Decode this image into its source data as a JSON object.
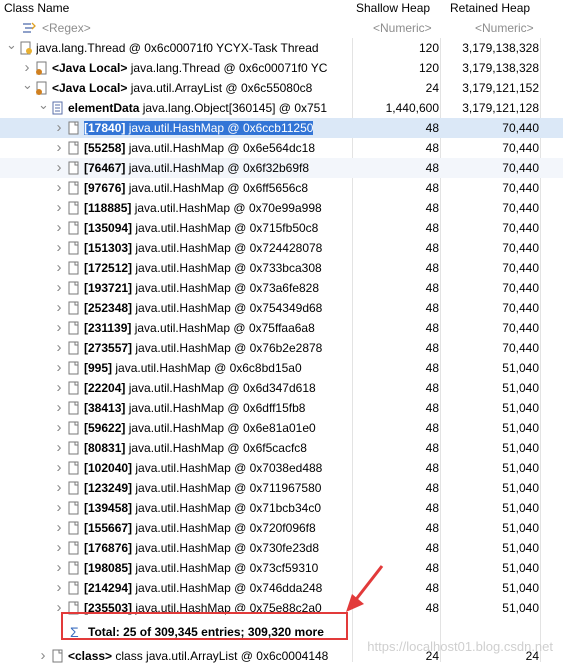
{
  "columns": {
    "class_name": "Class Name",
    "shallow_heap": "Shallow Heap",
    "retained_heap": "Retained Heap"
  },
  "filters": {
    "class_name": "<Regex>",
    "shallow_heap": "<Numeric>",
    "retained_heap": "<Numeric>"
  },
  "tree": [
    {
      "indent": 0,
      "expanded": true,
      "icon": "thread-icon",
      "text": "java.lang.Thread @ 0x6c00071f0  YCYX-Task Thread",
      "shallow": "120",
      "retained": "3,179,138,328"
    },
    {
      "indent": 1,
      "expanded": false,
      "icon": "local-icon",
      "text": "<Java Local> java.lang.Thread @ 0x6c00071f0  YC",
      "bold_prefix": "<Java Local>",
      "rest": " java.lang.Thread @ 0x6c00071f0  YC",
      "shallow": "120",
      "retained": "3,179,138,328"
    },
    {
      "indent": 1,
      "expanded": true,
      "icon": "local-icon",
      "text": "<Java Local> java.util.ArrayList @ 0x6c55080c8",
      "bold_prefix": "<Java Local>",
      "rest": " java.util.ArrayList @ 0x6c55080c8",
      "shallow": "24",
      "retained": "3,179,121,152"
    },
    {
      "indent": 2,
      "expanded": true,
      "icon": "array-icon",
      "text": "elementData java.lang.Object[360145] @ 0x751",
      "bold_prefix": "elementData",
      "rest": " java.lang.Object[360145] @ 0x751",
      "shallow": "1,440,600",
      "retained": "3,179,121,128"
    }
  ],
  "entries": [
    {
      "idx": "[17840]",
      "obj": "java.util.HashMap @ 0x6ccb11250",
      "shallow": "48",
      "retained": "70,440"
    },
    {
      "idx": "[55258]",
      "obj": "java.util.HashMap @ 0x6e564dc18",
      "shallow": "48",
      "retained": "70,440"
    },
    {
      "idx": "[76467]",
      "obj": "java.util.HashMap @ 0x6f32b69f8",
      "shallow": "48",
      "retained": "70,440"
    },
    {
      "idx": "[97676]",
      "obj": "java.util.HashMap @ 0x6ff5656c8",
      "shallow": "48",
      "retained": "70,440"
    },
    {
      "idx": "[118885]",
      "obj": "java.util.HashMap @ 0x70e99a998",
      "shallow": "48",
      "retained": "70,440"
    },
    {
      "idx": "[135094]",
      "obj": "java.util.HashMap @ 0x715fb50c8",
      "shallow": "48",
      "retained": "70,440"
    },
    {
      "idx": "[151303]",
      "obj": "java.util.HashMap @ 0x724428078",
      "shallow": "48",
      "retained": "70,440"
    },
    {
      "idx": "[172512]",
      "obj": "java.util.HashMap @ 0x733bca308",
      "shallow": "48",
      "retained": "70,440"
    },
    {
      "idx": "[193721]",
      "obj": "java.util.HashMap @ 0x73a6fe828",
      "shallow": "48",
      "retained": "70,440"
    },
    {
      "idx": "[252348]",
      "obj": "java.util.HashMap @ 0x754349d68",
      "shallow": "48",
      "retained": "70,440"
    },
    {
      "idx": "[231139]",
      "obj": "java.util.HashMap @ 0x75ffaa6a8",
      "shallow": "48",
      "retained": "70,440"
    },
    {
      "idx": "[273557]",
      "obj": "java.util.HashMap @ 0x76b2e2878",
      "shallow": "48",
      "retained": "70,440"
    },
    {
      "idx": "[995]",
      "obj": "java.util.HashMap @ 0x6c8bd15a0",
      "shallow": "48",
      "retained": "51,040"
    },
    {
      "idx": "[22204]",
      "obj": "java.util.HashMap @ 0x6d347d618",
      "shallow": "48",
      "retained": "51,040"
    },
    {
      "idx": "[38413]",
      "obj": "java.util.HashMap @ 0x6dff15fb8",
      "shallow": "48",
      "retained": "51,040"
    },
    {
      "idx": "[59622]",
      "obj": "java.util.HashMap @ 0x6e81a01e0",
      "shallow": "48",
      "retained": "51,040"
    },
    {
      "idx": "[80831]",
      "obj": "java.util.HashMap @ 0x6f5cacfc8",
      "shallow": "48",
      "retained": "51,040"
    },
    {
      "idx": "[102040]",
      "obj": "java.util.HashMap @ 0x7038ed488",
      "shallow": "48",
      "retained": "51,040"
    },
    {
      "idx": "[123249]",
      "obj": "java.util.HashMap @ 0x711967580",
      "shallow": "48",
      "retained": "51,040"
    },
    {
      "idx": "[139458]",
      "obj": "java.util.HashMap @ 0x71bcb34c0",
      "shallow": "48",
      "retained": "51,040"
    },
    {
      "idx": "[155667]",
      "obj": "java.util.HashMap @ 0x720f096f8",
      "shallow": "48",
      "retained": "51,040"
    },
    {
      "idx": "[176876]",
      "obj": "java.util.HashMap @ 0x730fe23d8",
      "shallow": "48",
      "retained": "51,040"
    },
    {
      "idx": "[198085]",
      "obj": "java.util.HashMap @ 0x73cf59310",
      "shallow": "48",
      "retained": "51,040"
    },
    {
      "idx": "[214294]",
      "obj": "java.util.HashMap @ 0x746dda248",
      "shallow": "48",
      "retained": "51,040"
    },
    {
      "idx": "[235503]",
      "obj": "java.util.HashMap @ 0x75e88c2a0",
      "shallow": "48",
      "retained": "51,040"
    }
  ],
  "total": {
    "text": "Total: 25 of 309,345 entries; 309,320 more"
  },
  "class_row": {
    "bold_prefix": "<class>",
    "rest": " class java.util.ArrayList @ 0x6c0004148",
    "shallow": "24",
    "retained": "24"
  },
  "watermark": "https://localhost01.blog.csdn.net",
  "colors": {
    "selection": "#3375d6",
    "highlight_box": "#e23a3a",
    "row_alt": "#f3f6fb"
  }
}
